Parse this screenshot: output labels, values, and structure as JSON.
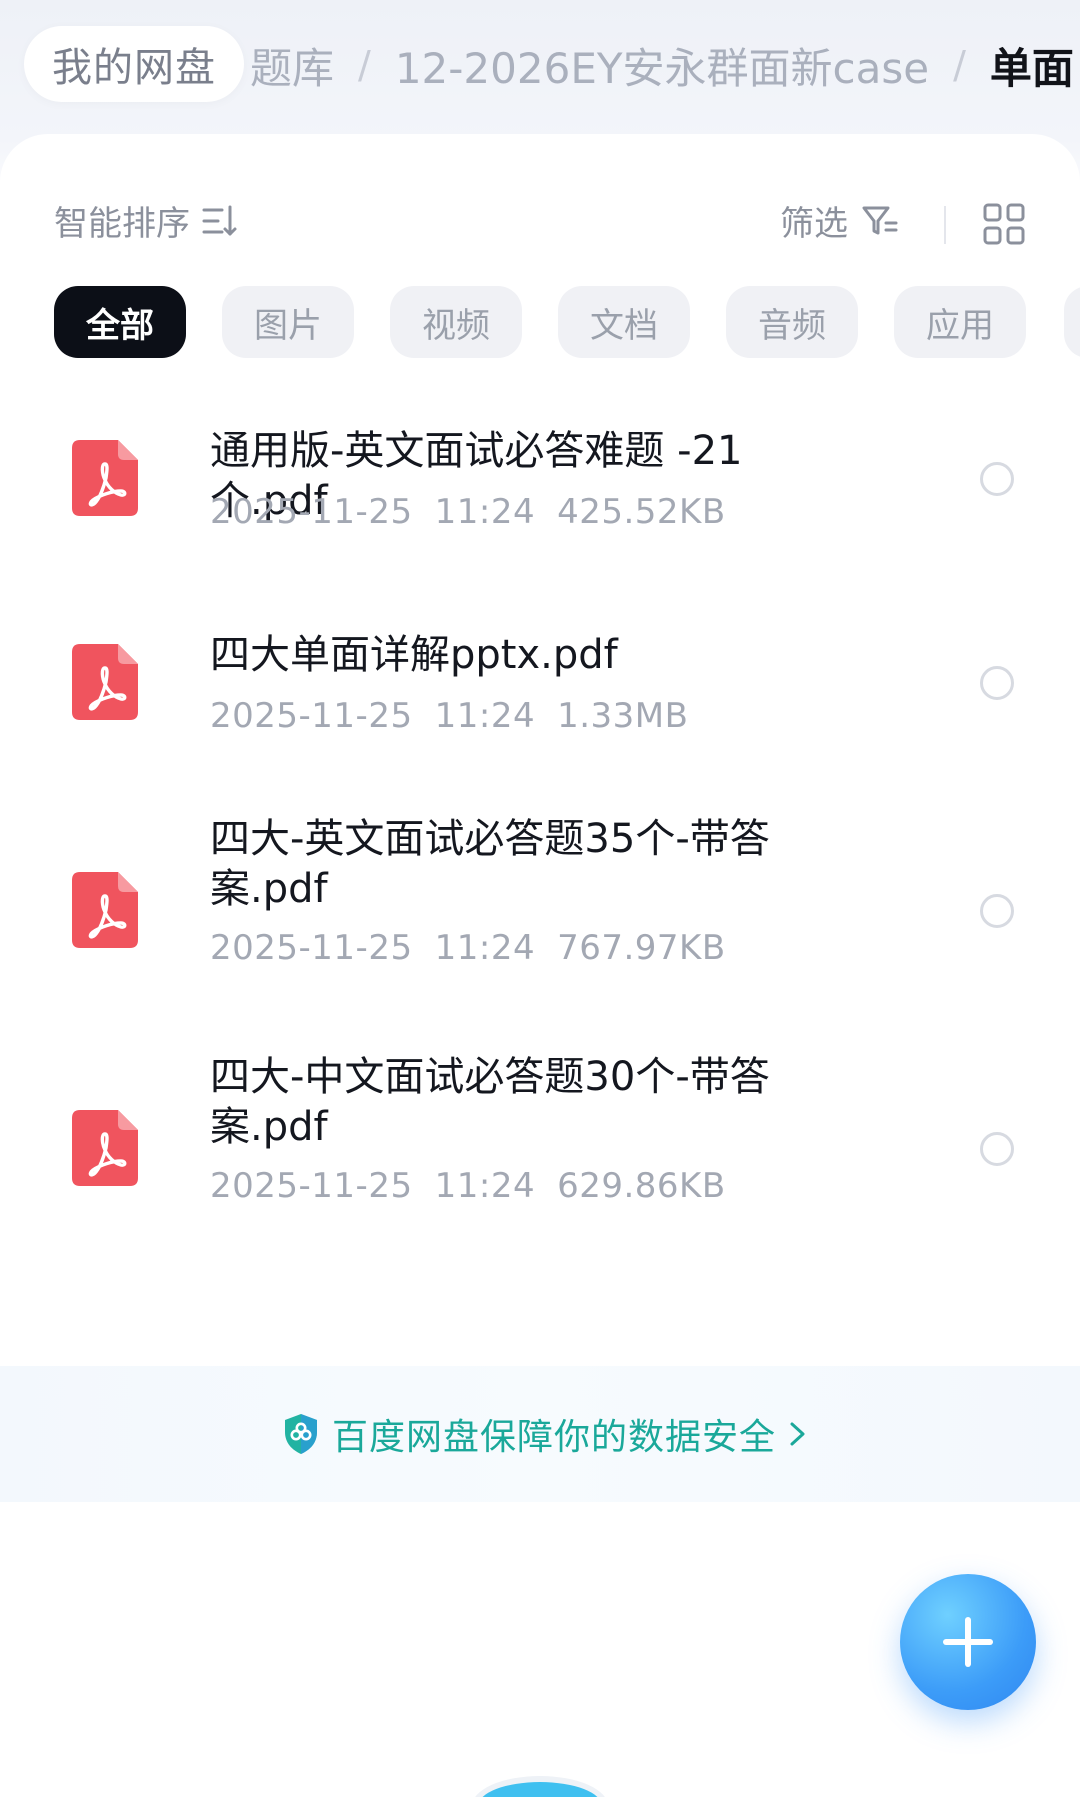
{
  "breadcrumb": {
    "root": "我的网盘",
    "items": [
      "题库",
      "12-2026EY安永群面新case"
    ],
    "separator": "/",
    "current": "单面"
  },
  "toolbar": {
    "sort_label": "智能排序",
    "filter_label": "筛选"
  },
  "chips": [
    {
      "label": "全部",
      "active": true
    },
    {
      "label": "图片",
      "active": false
    },
    {
      "label": "视频",
      "active": false
    },
    {
      "label": "文档",
      "active": false
    },
    {
      "label": "音频",
      "active": false
    },
    {
      "label": "应用",
      "active": false
    }
  ],
  "files": [
    {
      "name": "通用版-英文面试必答难题 -21个.pdf",
      "date": "2025-11-25",
      "time": "11:24",
      "size": "425.52KB",
      "icon": "pdf-icon"
    },
    {
      "name": "四大单面详解pptx.pdf",
      "date": "2025-11-25",
      "time": "11:24",
      "size": "1.33MB",
      "icon": "pdf-icon"
    },
    {
      "name": "四大-英文面试必答题35个-带答案.pdf",
      "date": "2025-11-25",
      "time": "11:24",
      "size": "767.97KB",
      "icon": "pdf-icon"
    },
    {
      "name": "四大-中文面试必答题30个-带答案.pdf",
      "date": "2025-11-25",
      "time": "11:24",
      "size": "629.86KB",
      "icon": "pdf-icon"
    }
  ],
  "security": {
    "text": "百度网盘保障你的数据安全"
  },
  "fab": {
    "icon": "plus-icon"
  },
  "colors": {
    "accent": "#3c9cf8",
    "pdf": "#f0545e",
    "security_text": "#1aa89a",
    "chip_active": "#0c0f17"
  }
}
